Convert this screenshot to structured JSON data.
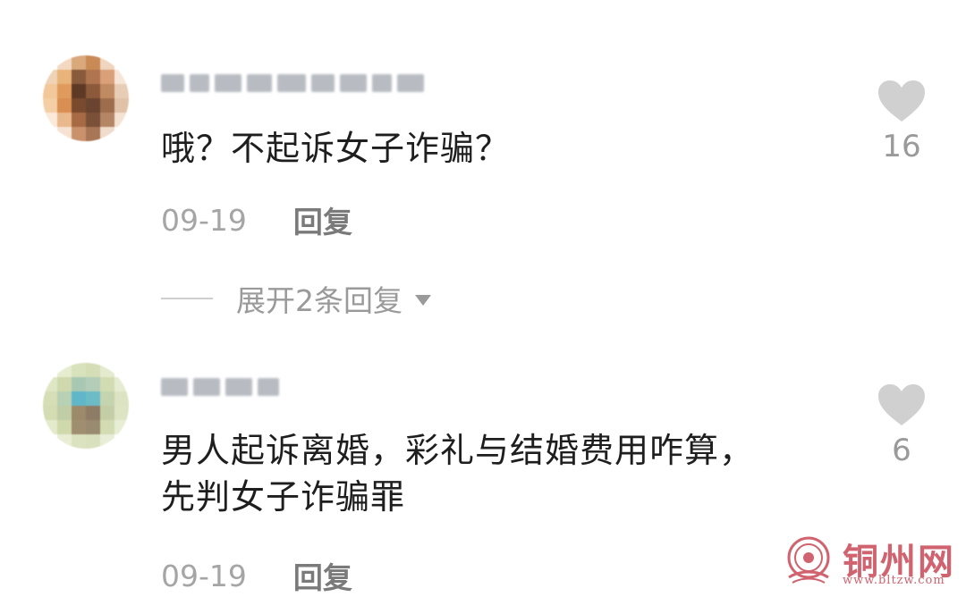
{
  "comments": [
    {
      "text": "哦？不起诉女子诈骗？",
      "date": "09-19",
      "reply_label": "回复",
      "like_count": "16",
      "avatar_colors": [
        "#ffffff",
        "#f3d9c2",
        "#d9a97c",
        "#c98a56",
        "#f0d5bf",
        "#ffffff",
        "#efd3b6",
        "#e8b47a",
        "#8a5a3c",
        "#b07550",
        "#d9a07a",
        "#f7e6d8",
        "#f2c79a",
        "#e09a5c",
        "#5e3a26",
        "#8c5a3a",
        "#c08a62",
        "#e8cdb6",
        "#f4cfa6",
        "#d98e52",
        "#7a4a2e",
        "#6a4430",
        "#9e6d4e",
        "#e0c2a8",
        "#fbe9d9",
        "#e9b88c",
        "#a86a44",
        "#7a5038",
        "#b48666",
        "#f4e2d2",
        "#ffffff",
        "#f6e2d2",
        "#c9926c",
        "#a87656",
        "#efdccc",
        "#ffffff"
      ]
    },
    {
      "text": "男人起诉离婚，彩礼与结婚费用咋算，先判女子诈骗罪",
      "date": "09-19",
      "reply_label": "回复",
      "like_count": "6",
      "avatar_colors": [
        "#ffffff",
        "#e6ecd0",
        "#d8e2bc",
        "#d4ddb6",
        "#e4eacd",
        "#ffffff",
        "#dfe6c4",
        "#cfd9ad",
        "#a9c8b4",
        "#b3cdb8",
        "#d2dcb2",
        "#e6ecd2",
        "#d5deb4",
        "#b8d0b4",
        "#5fb7c9",
        "#6cbcc8",
        "#c3d4ae",
        "#dbe3c2",
        "#d3dcb2",
        "#c0cda6",
        "#9c8a6a",
        "#8e7c66",
        "#c4cea6",
        "#dce4c4",
        "#e4eacc",
        "#d0d9ac",
        "#a08e70",
        "#9a8a70",
        "#d2dbb2",
        "#e8eed6",
        "#ffffff",
        "#e8edd4",
        "#dbe2c0",
        "#d9e0be",
        "#e9eed8",
        "#ffffff"
      ]
    }
  ],
  "expand_replies_label": "展开2条回复",
  "watermark": {
    "name": "铜州网",
    "url": "www.bltzw.com"
  },
  "colors": {
    "placeholder_text": "#b8bcc2",
    "heart": "#d0d0d0",
    "watermark": "#d0636f"
  }
}
